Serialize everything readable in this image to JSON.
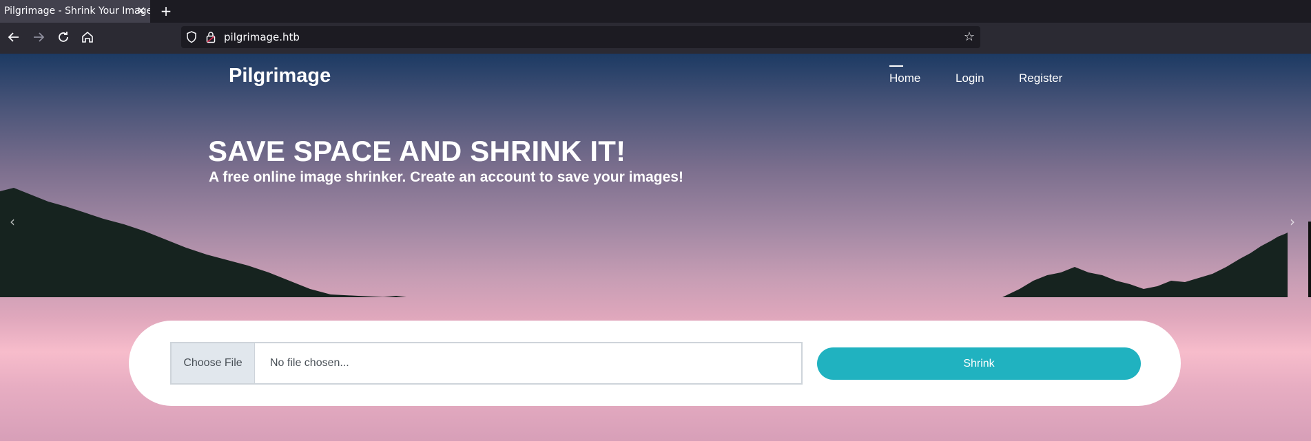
{
  "browser": {
    "tab_title": "Pilgrimage - Shrink Your Images",
    "tab_close_icon": "close-icon",
    "new_tab_icon": "plus-icon",
    "url": "pilgrimage.htb",
    "nav_icons": [
      "back-icon",
      "forward-icon",
      "reload-icon",
      "home-icon"
    ],
    "url_icons": [
      "shield-icon",
      "lock-icon",
      "star-icon"
    ]
  },
  "site": {
    "brand": "Pilgrimage",
    "menu": [
      {
        "label": "Home",
        "active": true
      },
      {
        "label": "Login",
        "active": false
      },
      {
        "label": "Register",
        "active": false
      }
    ]
  },
  "hero": {
    "title": "SAVE SPACE AND SHRINK IT!",
    "subtitle": "A free online image shrinker. Create an account to save your images!",
    "prev_icon": "chevron-left-icon",
    "next_icon": "chevron-right-icon"
  },
  "upload": {
    "choose_label": "Choose File",
    "status": "No file chosen...",
    "submit_label": "Shrink"
  },
  "colors": {
    "accent": "#20b2c0",
    "sky_top": "#1c3a63",
    "sky_bottom": "#f7bccb",
    "mountain": "#16231f"
  }
}
